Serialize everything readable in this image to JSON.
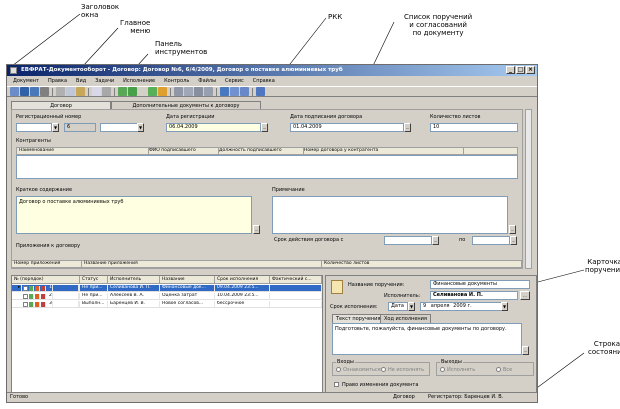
{
  "annotations": {
    "title_bar": "Заголовок\nокна",
    "main_menu": "Главное\nменю",
    "toolbar": "Панель\nинструментов",
    "rkk": "РКК",
    "orders_list": "Список поручений\nи согласований\nпо документу",
    "order_card": "Карточка\nпоручения",
    "status_bar": "Строка\nсостояния"
  },
  "window": {
    "title": "ЕВФРАТ-Документооборот - Договор: Договор №6, 6/4/2009, Договор о поставке алюминиевых труб",
    "min": "_",
    "max": "□",
    "close": "×"
  },
  "menu": [
    "Документ",
    "Правка",
    "Вид",
    "Задачи",
    "Исполнение",
    "Контроль",
    "Файлы",
    "Сервис",
    "Справка"
  ],
  "tabs": [
    "Договор",
    "Дополнительные документы к договору"
  ],
  "form": {
    "reg_number_label": "Регистрационный номер",
    "reg_number_value": "6",
    "reg_date_label": "Дата регистрации",
    "reg_date_value": "06.04.2009",
    "sign_date_label": "Дата подписания договора",
    "sign_date_value": "01.04.2009",
    "sheets_label": "Количество листов",
    "sheets_value": "10",
    "contractors_label": "Контрагенты",
    "contractors_columns": [
      "Наименование",
      "ФИО подписавшего",
      "Должность подписавшего",
      "Номер договора у контрагента"
    ],
    "summary_label": "Краткое содержание",
    "summary_value": "Договор о поставке алюминиевых труб",
    "note_label": "Примечание",
    "attachments_label": "Приложения к договору",
    "term_label": "Срок действия договора с",
    "term_to": "по",
    "attach_columns": [
      "Номер приложения",
      "Название приложения",
      "Количество листов"
    ],
    "ellipsis": "..."
  },
  "orders": {
    "columns": [
      "№ (порядок)",
      "Статус",
      "Исполнитель",
      "Название",
      "Срок исполнения",
      "Фактический с..."
    ],
    "rows": [
      {
        "num": "1",
        "status": "Не при...",
        "executor": "Селиванова И. П.",
        "name": "Финансовые док...",
        "due": "09.04.2009 23:5...",
        "fact": ""
      },
      {
        "num": "2",
        "status": "Не при...",
        "executor": "Алексеев В. А.",
        "name": "Оценка затрат",
        "due": "10.04.2009 23:5...",
        "fact": ""
      },
      {
        "num": "3",
        "status": "Выполн...",
        "executor": "Баренцев И. В.",
        "name": "Новое согласов...",
        "due": "бессрочное",
        "fact": ""
      }
    ]
  },
  "card": {
    "name_label": "Название поручения:",
    "name_value": "Финансовые документы",
    "executor_label": "Исполнитель:",
    "executor_value": "Селиванова И. П.",
    "due_label": "Срок исполнения:",
    "due_type": "Дата",
    "due_day": "9",
    "due_month": "апреля",
    "due_year": "2009 г.",
    "tab_text": "Текст поручения",
    "tab_history": "Ход исполнения",
    "text_value": "Подготовьте, пожалуйста, финансовые документы по договору.",
    "inputs_label": "Входы",
    "outputs_label": "Выходы",
    "opt_none": "Нет",
    "opt_no_execute": "Не исполнять",
    "opt_execute": "Исполнять",
    "opt_review": "Ознакомиться",
    "opt_all": "Все",
    "change_rights_label": "Право изменения документа"
  },
  "status": {
    "left": "Готово",
    "doc_type": "Договор",
    "registrar": "Регистратор: Баренцев И. В."
  },
  "colors": {
    "title_start": "#0a246a",
    "title_end": "#a6caf0",
    "selection": "#316ac5",
    "field_yellow": "#ffffe1"
  }
}
